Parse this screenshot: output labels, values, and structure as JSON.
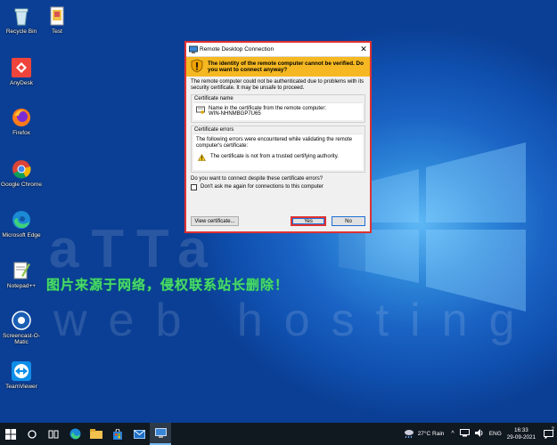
{
  "desktop": {
    "icons": [
      {
        "label": "Recycle Bin",
        "icon": "recycle-bin-icon"
      },
      {
        "label": "Test",
        "icon": "file-icon"
      },
      {
        "label": "AnyDesk",
        "icon": "anydesk-icon"
      },
      {
        "label": "Firefox",
        "icon": "firefox-icon"
      },
      {
        "label": "Google Chrome",
        "icon": "chrome-icon"
      },
      {
        "label": "Microsoft Edge",
        "icon": "edge-icon"
      },
      {
        "label": "Notepad++",
        "icon": "notepadpp-icon"
      },
      {
        "label": "Screencast-O-Matic",
        "icon": "screencast-icon"
      },
      {
        "label": "TeamViewer",
        "icon": "teamviewer-icon"
      }
    ],
    "watermark_logo": "aTTa",
    "watermark_sub": "web hosting",
    "watermark_cn": "图片来源于网络，侵权联系站长删除！"
  },
  "dialog": {
    "title": "Remote Desktop Connection",
    "warning": "The identity of the remote computer cannot be verified. Do you want to connect anyway?",
    "intro": "The remote computer could not be authenticated due to problems with its security certificate. It may be unsafe to proceed.",
    "cert_name_title": "Certificate name",
    "cert_name_label": "Name in the certificate from the remote computer:",
    "cert_name_value": "WIN-NHNMBGP7U65",
    "cert_errors_title": "Certificate errors",
    "cert_errors_text": "The following errors were encountered while validating the remote computer's certificate:",
    "cert_error_item": "The certificate is not from a trusted certifying authority.",
    "question": "Do you want to connect despite these certificate errors?",
    "checkbox_label": "Don't ask me again for connections to this computer",
    "view_cert_button": "View certificate...",
    "yes_button": "Yes",
    "no_button": "No",
    "highlight_color": "#e03131",
    "warning_color": "#f5b822"
  },
  "taskbar": {
    "weather": "27°C  Rain",
    "language": "ENG",
    "time": "16:33",
    "date": "29-09-2021",
    "notification_count": "2"
  }
}
